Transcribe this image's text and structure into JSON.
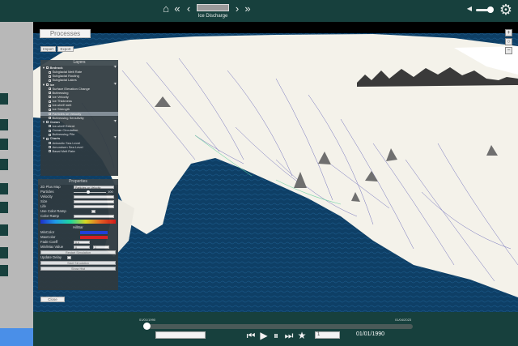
{
  "topbar": {
    "title": "Ice Discharge",
    "icons": {
      "home": "home-icon",
      "first": "double-chevron-left-icon",
      "prev": "chevron-left-icon",
      "next": "chevron-right-icon",
      "last": "double-chevron-right-icon",
      "volume": "volume-icon",
      "settings": "gear-icon"
    }
  },
  "processes": {
    "label": "Processes",
    "import_label": "Import",
    "export_label": "Export"
  },
  "layers": {
    "title": "Layers",
    "rows": [
      {
        "label": "Bedrock",
        "group": true
      },
      {
        "label": "Subglacial Melt Rate"
      },
      {
        "label": "Subglacial Routing"
      },
      {
        "label": "Subglacial Lakes"
      },
      {
        "label": "Ice",
        "group": true
      },
      {
        "label": "Surface Elevation Change"
      },
      {
        "label": "Buttressing"
      },
      {
        "label": "Ice Velocity"
      },
      {
        "label": "Ice Thickness"
      },
      {
        "label": "Ice-shelf melt"
      },
      {
        "label": "Ice Strength"
      },
      {
        "label": "Particles on Velocity",
        "selected": true
      },
      {
        "label": "Buttressing Sensitivity"
      },
      {
        "label": "Ocean",
        "group": true
      },
      {
        "label": "Ice-shelf Extent"
      },
      {
        "label": "Ocean Circulation"
      },
      {
        "label": "Buttressing Pile"
      },
      {
        "label": "Charts",
        "group": true
      },
      {
        "label": "Antarctic Sea Level"
      },
      {
        "label": "Amundsen Sea Level"
      },
      {
        "label": "Basal Melt Rate"
      }
    ]
  },
  "properties": {
    "title": "Properties",
    "rows": {
      "mode_label": "2D Plus Map",
      "mode_value": "Particles on Velocity",
      "particles_label": "Particles",
      "particles_value": "100",
      "velocity_label": "Velocity",
      "size_label": "Size",
      "life_label": "Life",
      "ramp_label": "Use Color Ramp",
      "ramp_name_label": "Color Ramp",
      "mincolor_label": "MinColor",
      "maxcolor_label": "MaxColor",
      "fade_label": "Fade Coeff",
      "fade_value": "0.9",
      "minmax_label": "Min/Max Value",
      "min_value": "0",
      "max_value": "1",
      "update_label": "Update Delay",
      "hillbar_label": "HillBar",
      "recompute_label": "Restart Simulation",
      "btn_start": "Start Simulation",
      "btn_show": "Show Hist"
    },
    "colors": {
      "min": "#2040e0",
      "max": "#e02020"
    }
  },
  "close_label": "Close",
  "timeline": {
    "start_label": "01/01/1990",
    "end_label": "01/04/2023",
    "current_date": "01/01/1990",
    "step_value": "1",
    "progress": 0.0
  },
  "colors": {
    "bar": "#17403d",
    "ocean": "#0c3a5e",
    "accent": "#4a8fe8"
  }
}
